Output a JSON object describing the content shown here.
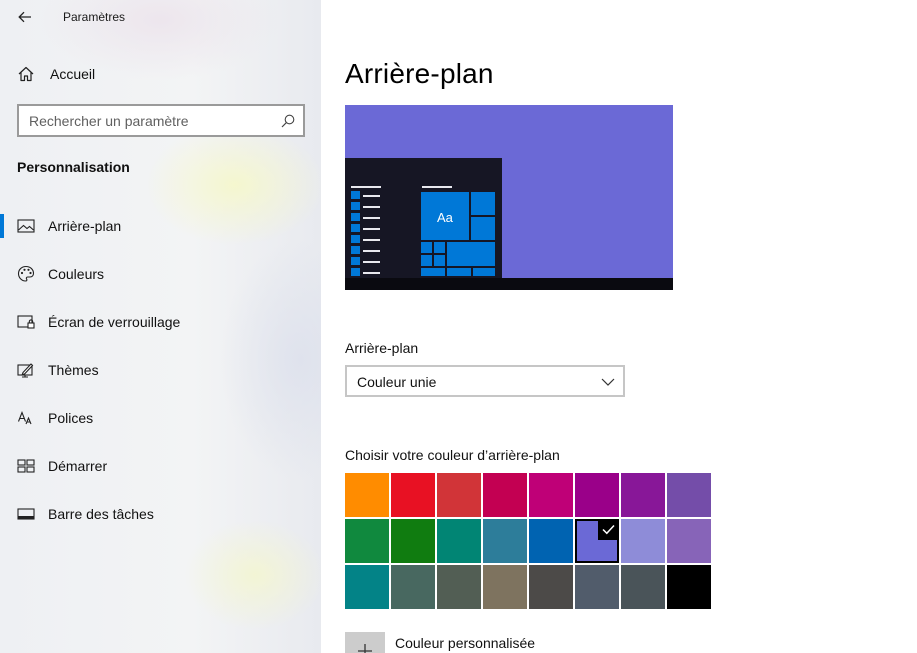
{
  "window": {
    "title": "Paramètres"
  },
  "sidebar": {
    "home_label": "Accueil",
    "search_placeholder": "Rechercher un paramètre",
    "section_title": "Personnalisation",
    "items": [
      {
        "label": "Arrière-plan",
        "icon": "picture-icon",
        "selected": true
      },
      {
        "label": "Couleurs",
        "icon": "palette-icon",
        "selected": false
      },
      {
        "label": "Écran de verrouillage",
        "icon": "lock-screen-icon",
        "selected": false
      },
      {
        "label": "Thèmes",
        "icon": "themes-icon",
        "selected": false
      },
      {
        "label": "Polices",
        "icon": "fonts-icon",
        "selected": false
      },
      {
        "label": "Démarrer",
        "icon": "start-icon",
        "selected": false
      },
      {
        "label": "Barre des tâches",
        "icon": "taskbar-icon",
        "selected": false
      }
    ]
  },
  "main": {
    "title": "Arrière-plan",
    "preview": {
      "background_color": "#6b69d6",
      "tile_text": "Aa"
    },
    "background_label": "Arrière-plan",
    "background_value": "Couleur unie",
    "colors_label": "Choisir votre couleur d’arrière-plan",
    "swatches": [
      [
        "#ff8c00",
        "#e81123",
        "#d13438",
        "#c30052",
        "#bf0077",
        "#9a0089",
        "#881798",
        "#744da9"
      ],
      [
        "#10893e",
        "#107c10",
        "#018574",
        "#2d7d9a",
        "#0063b1",
        "#6b69d6",
        "#8e8cd8",
        "#8764b8"
      ],
      [
        "#038387",
        "#486860",
        "#525e54",
        "#7e735f",
        "#4c4a48",
        "#515c6b",
        "#4a5459",
        "#000000"
      ]
    ],
    "selected_swatch": {
      "row": 1,
      "col": 5
    },
    "custom_color_label": "Couleur personnalisée"
  },
  "colors": {
    "accent": "#0078d7"
  }
}
